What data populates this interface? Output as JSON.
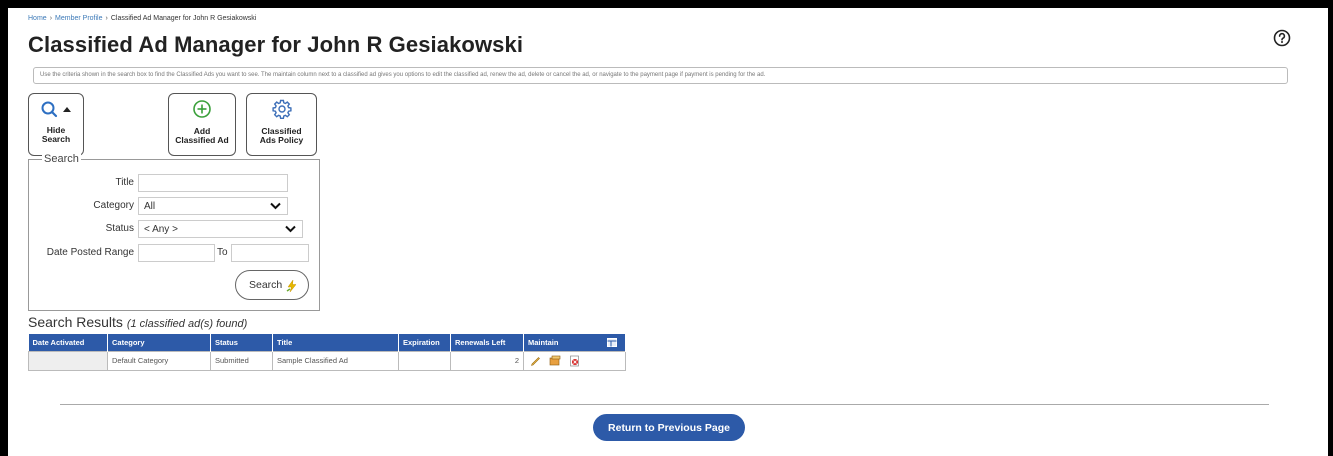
{
  "breadcrumb": {
    "home": "Home",
    "member_profile": "Member Profile",
    "current": "Classified Ad Manager for John R Gesiakowski",
    "separator": "›"
  },
  "page_title": "Classified Ad Manager for John R Gesiakowski",
  "help_icon": "help-circle-icon",
  "info_text": "Use the criteria shown in the search box to find the Classified Ads you want to see. The maintain column next to a classified ad gives you options to edit the classified ad, renew the ad, delete or cancel the ad, or navigate to the payment page if payment is pending for the ad.",
  "toolbar": {
    "hide_search": {
      "line1": "Hide",
      "line2": "Search",
      "icon": "search-icon"
    },
    "add_ad": {
      "line1": "Add",
      "line2": "Classified Ad",
      "icon": "plus-circle-icon"
    },
    "policy": {
      "line1": "Classified",
      "line2": "Ads Policy",
      "icon": "gear-icon"
    }
  },
  "search": {
    "legend": "Search",
    "title_label": "Title",
    "title_value": "",
    "category_label": "Category",
    "category_value": "All",
    "status_label": "Status",
    "status_value": "< Any >",
    "date_label": "Date Posted Range",
    "date_from": "",
    "to_label": "To",
    "date_to": "",
    "button_label": "Search"
  },
  "results": {
    "title": "Search Results",
    "count_text": "(1 classified ad(s) found)",
    "columns": [
      "Date Activated",
      "Category",
      "Status",
      "Title",
      "Expiration",
      "Renewals Left",
      "Maintain"
    ],
    "rows": [
      {
        "date_activated": "",
        "category": "Default Category",
        "status": "Submitted",
        "title": "Sample Classified Ad",
        "expiration": "",
        "renewals_left": "2"
      }
    ]
  },
  "return_button": "Return to Previous Page",
  "colors": {
    "accent": "#2d5aa8",
    "link": "#3d7ab8",
    "green": "#3aa03a",
    "gear": "#3d6fb8"
  }
}
